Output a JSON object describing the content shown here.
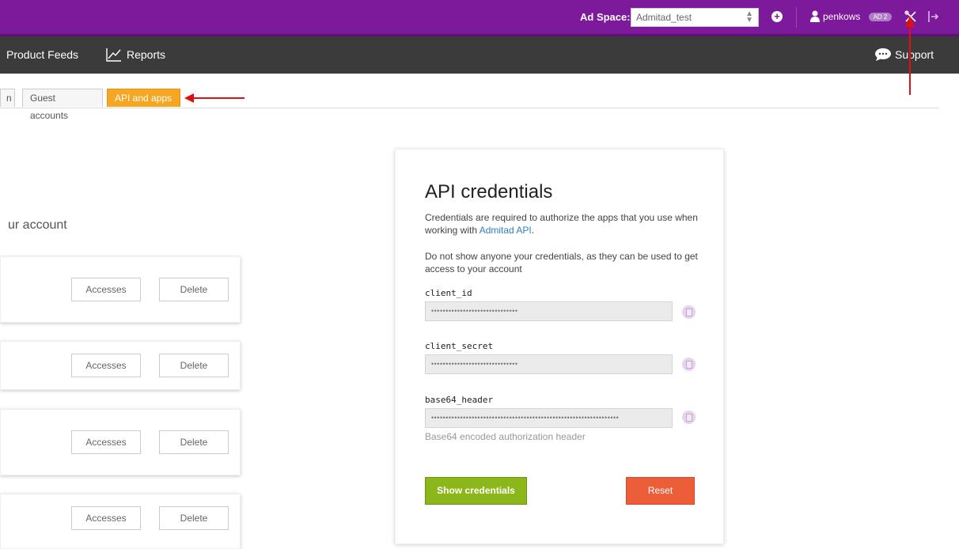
{
  "topbar": {
    "ad_space_label": "Ad Space:",
    "ad_space_value": "Admitad_test",
    "username": "penkows",
    "badge": "AD 2"
  },
  "nav": {
    "product_feeds": "Product Feeds",
    "reports": "Reports",
    "support": "Support"
  },
  "tabs": {
    "partial": "n",
    "guest": "Guest accounts",
    "api": "API and apps"
  },
  "left": {
    "section_title": "ur account",
    "cards": [
      {
        "accesses": "Accesses",
        "delete": "Delete"
      },
      {
        "accesses": "Accesses",
        "delete": "Delete"
      },
      {
        "accesses": "Accesses",
        "delete": "Delete"
      },
      {
        "accesses": "Accesses",
        "delete": "Delete"
      }
    ]
  },
  "panel": {
    "title": "API credentials",
    "desc1_prefix": "Credentials are required to authorize the apps that you use when working with ",
    "desc1_link": "Admitad API",
    "desc1_suffix": ".",
    "desc2": "Do not show anyone your credentials, as they can be used to get access to your account",
    "client_id_label": "client_id",
    "client_id_value": "••••••••••••••••••••••••••••••",
    "client_secret_label": "client_secret",
    "client_secret_value": "••••••••••••••••••••••••••••••",
    "base64_label": "base64_header",
    "base64_value": "•••••••••••••••••••••••••••••••••••••••••••••••••••••••••••••••••",
    "base64_hint": "Base64 encoded authorization header",
    "show_button": "Show credentials",
    "reset_button": "Reset"
  },
  "colors": {
    "topbar": "#7d1a9b",
    "navbar": "#3b3b3b",
    "active_tab": "#f5a623",
    "show_button": "#8cb71b",
    "reset_button": "#ec5e3a",
    "annotation_arrow": "#e01010"
  },
  "icons": [
    "plus-circle-icon",
    "user-icon",
    "tools-icon",
    "logout-icon",
    "chart-line-icon",
    "speech-bubble-icon",
    "copy-icon"
  ]
}
